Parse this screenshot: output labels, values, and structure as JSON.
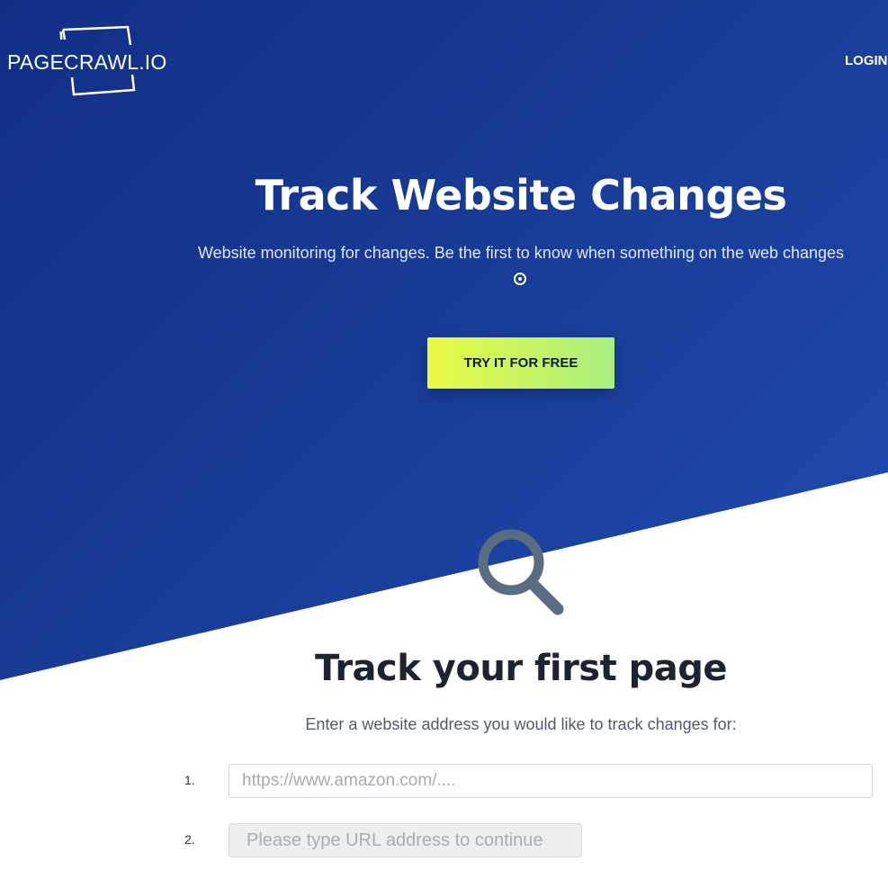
{
  "header": {
    "logo_text": "PAGECRAWL.IO",
    "login_label": "LOGIN"
  },
  "hero": {
    "title": "Track Website Changes",
    "subtitle": "Website monitoring for changes. Be the first to know when something on the web changes",
    "cta_label": "TRY IT FOR FREE",
    "icons": {
      "indicator": "radio-dot-icon"
    }
  },
  "track": {
    "icon": "magnifier-icon",
    "title": "Track your first page",
    "subtitle": "Enter a website address you would like to track changes for:",
    "steps": [
      {
        "number": "1.",
        "input_placeholder": "https://www.amazon.com/...."
      },
      {
        "number": "2.",
        "button_label": "Please type URL address to continue"
      }
    ]
  },
  "colors": {
    "hero_gradient_start": "#122f86",
    "hero_gradient_end": "#1f4bb0",
    "cta_gradient_start": "#e8fa43",
    "cta_gradient_end": "#a9ef7f",
    "magnifier": "#5a6c82",
    "heading_dark": "#1c2433"
  }
}
